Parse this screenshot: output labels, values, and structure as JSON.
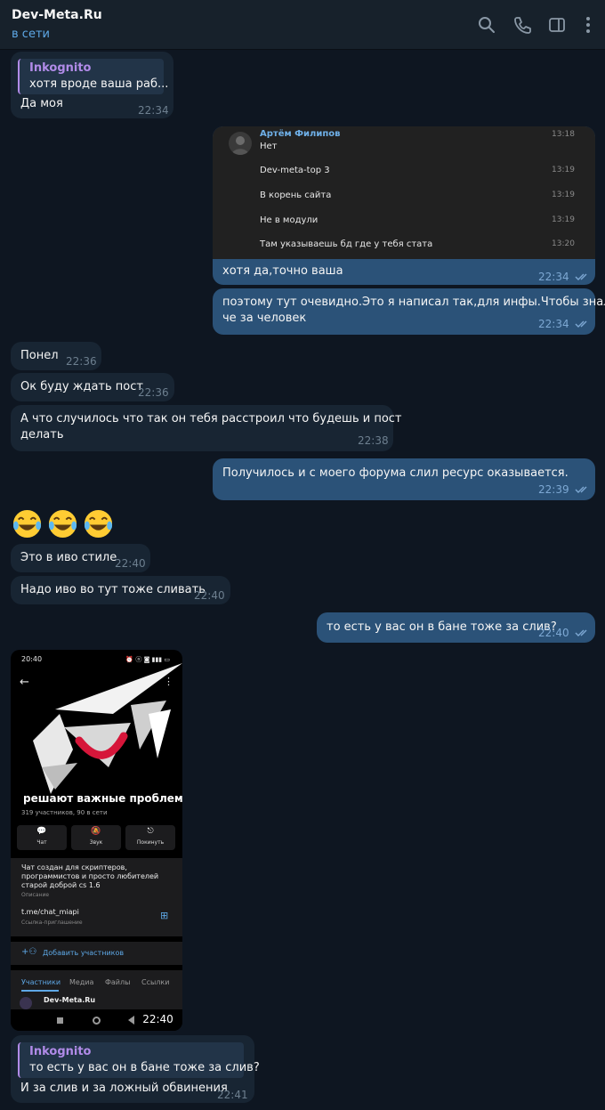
{
  "header": {
    "title": "Dev-Meta.Ru",
    "status": "в сети",
    "icons": [
      "search-icon",
      "phone-icon",
      "sidebar-icon",
      "more-icon"
    ]
  },
  "messages": {
    "m1": {
      "reply_name": "Inkognito",
      "reply_text": "хотя вроде ваша раб...",
      "text": "Да моя",
      "time": "22:34"
    },
    "m2": {
      "screenshot": {
        "sender": "Артём Филипов",
        "lines": [
          {
            "text": "Нет",
            "time": "13:18"
          },
          {
            "text": "Dev-meta-top 3",
            "time": "13:19"
          },
          {
            "text": "В корень сайта",
            "time": "13:19"
          },
          {
            "text": "Не в модули",
            "time": "13:19"
          },
          {
            "text": "Там указываешь бд где у тебя стата",
            "time": "13:20"
          }
        ]
      },
      "text": "хотя да,точно ваша",
      "time": "22:34"
    },
    "m3": {
      "line1": "поэтому тут очевидно.Это я написал так,для инфы.Чтобы знали",
      "line2": "че за человек",
      "time": "22:34"
    },
    "m4": {
      "text": "Понел",
      "time": "22:36"
    },
    "m5": {
      "text": "Ок буду ждать пост",
      "time": "22:36"
    },
    "m6": {
      "line1": "А что случилось что так он тебя расстроил что будешь  и пост",
      "line2": "делать",
      "time": "22:38"
    },
    "m7": {
      "text": "Получилось и с моего форума слил ресурс оказывается.",
      "time": "22:39"
    },
    "m8": {
      "emoji": "😂😂😂"
    },
    "m9": {
      "text": "Это в иво стиле",
      "time": "22:40"
    },
    "m10": {
      "text": "Надо иво во тут тоже сливать",
      "time": "22:40"
    },
    "m11": {
      "text": "то есть у вас он в бане тоже за слив?",
      "time": "22:40"
    },
    "m12": {
      "time": "22:40",
      "phone": {
        "clock": "20:40",
        "status_icons": "⏰ ⓝ ◙ ▮▮▮ ▭",
        "group_name": "решают важные проблемы",
        "group_sub": "319 участников, 90 в сети",
        "buttons": [
          {
            "icon": "💬",
            "label": "Чат"
          },
          {
            "icon": "🔕",
            "label": "Звук"
          },
          {
            "icon": "⎋",
            "label": "Покинуть"
          }
        ],
        "description_lines": [
          "Чат создан для скриптеров,",
          "программистов и просто любителей",
          "старой доброй cs 1.6"
        ],
        "description_label": "Описание",
        "link": "t.me/chat_miapi",
        "link_label": "Ссылка-приглашение",
        "add_members": "Добавить участников",
        "tabs": [
          "Участники",
          "Медиа",
          "Файлы",
          "Ссылки"
        ],
        "member_name": "Dev-Meta.Ru"
      }
    },
    "m13": {
      "reply_name": "Inkognito",
      "reply_text": "то есть у вас он в бане тоже за слив?",
      "text": "И за слив и за ложный обвинения",
      "time": "22:41"
    }
  },
  "colors": {
    "background": "#0e1621",
    "header": "#17212b",
    "incoming": "#182533",
    "outgoing": "#2b5278",
    "accent": "#5ea8e6",
    "reply_name": "#b18be8"
  }
}
